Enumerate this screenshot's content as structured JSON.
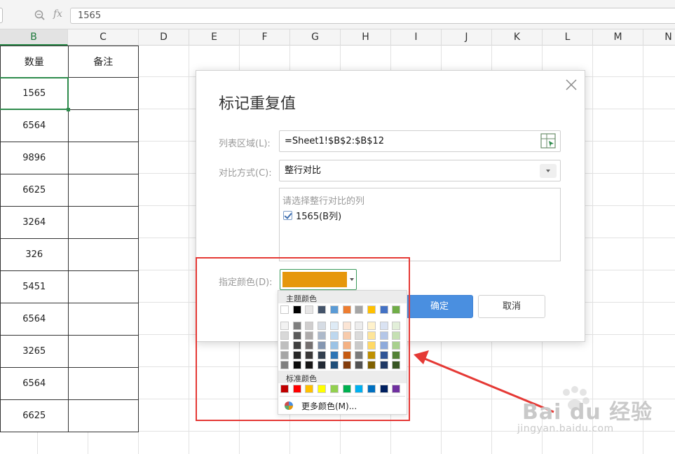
{
  "formula_bar": {
    "value": "1565",
    "fx": "fx"
  },
  "columns": [
    "B",
    "C",
    "D",
    "E",
    "F",
    "G",
    "H",
    "I",
    "J",
    "K",
    "L",
    "M",
    "N"
  ],
  "table": {
    "headers": [
      "数量",
      "备注"
    ],
    "rows": [
      "1565",
      "6564",
      "9896",
      "6625",
      "3264",
      "326",
      "5451",
      "6564",
      "3265",
      "6564",
      "6625"
    ]
  },
  "dialog": {
    "title": "标记重复值",
    "range_label": "列表区域(L):",
    "range_value": "=Sheet1!$B$2:$B$12",
    "mode_label": "对比方式(C):",
    "mode_value": "整行对比",
    "list_title": "请选择整行对比的列",
    "list_item": "1565(B列)",
    "color_label": "指定颜色(D):",
    "selected_color": "#e6970c",
    "ok": "确定",
    "cancel": "取消"
  },
  "palette": {
    "theme_label": "主题颜色",
    "standard_label": "标准颜色",
    "more_label": "更多颜色(M)...",
    "theme_top": [
      "#ffffff",
      "#000000",
      "#e7e6e6",
      "#44546a",
      "#5b9bd5",
      "#ed7d31",
      "#a5a5a5",
      "#ffc000",
      "#4472c4",
      "#70ad47"
    ],
    "theme_shades": [
      [
        "#f2f2f2",
        "#7f7f7f",
        "#d0cece",
        "#d6dce4",
        "#deebf6",
        "#fbe5d5",
        "#ededed",
        "#fff2cc",
        "#dae3f3",
        "#e2efd9"
      ],
      [
        "#d8d8d8",
        "#595959",
        "#aeabab",
        "#adb9ca",
        "#bdd7ee",
        "#f7cbac",
        "#dbdbdb",
        "#fee599",
        "#b4c6e7",
        "#c5e0b3"
      ],
      [
        "#bfbfbf",
        "#3f3f3f",
        "#757070",
        "#8496b0",
        "#9cc3e5",
        "#f4b183",
        "#c9c9c9",
        "#ffd965",
        "#8eaadb",
        "#a8d08d"
      ],
      [
        "#a5a5a5",
        "#262626",
        "#3a3838",
        "#323f4f",
        "#2e75b5",
        "#c55a11",
        "#7b7b7b",
        "#bf9000",
        "#2f5496",
        "#538135"
      ],
      [
        "#7f7f7f",
        "#0c0c0c",
        "#171616",
        "#222a35",
        "#1f4e79",
        "#833c0b",
        "#525252",
        "#7f6000",
        "#1f3864",
        "#375623"
      ]
    ],
    "standard": [
      "#c00000",
      "#ff0000",
      "#ffc000",
      "#ffff00",
      "#92d050",
      "#00b050",
      "#00b0f0",
      "#0070c0",
      "#002060",
      "#7030a0"
    ]
  },
  "watermark": {
    "brand": "Bai du 经验",
    "sub": "jingyan.baidu.com"
  }
}
